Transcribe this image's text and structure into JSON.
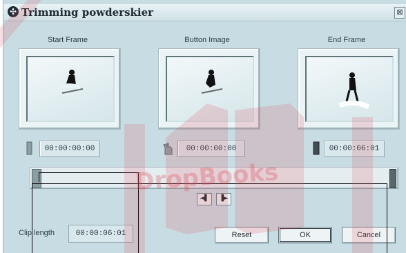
{
  "window": {
    "title": "Trimming powderskier",
    "close_glyph": "⊠"
  },
  "frames": [
    {
      "label": "Start Frame",
      "timecode": "00:00:00:00",
      "icon": "start-marker-icon"
    },
    {
      "label": "Button Image",
      "timecode": "00:00:00:00",
      "icon": "hand-pointer-icon"
    },
    {
      "label": "End Frame",
      "timecode": "00:00:06:01",
      "icon": "end-marker-icon"
    }
  ],
  "scrubber": {
    "step_back_glyph": "◄▌",
    "step_forward_glyph": "▐►"
  },
  "clip": {
    "label": "Clip length",
    "value": "00:00:06:01"
  },
  "buttons": {
    "reset": "Reset",
    "ok": "OK",
    "cancel": "Cancel"
  },
  "watermark": {
    "text": "DropBooks"
  },
  "colors": {
    "window_bg": "#c8dde3",
    "watermark": "#e04a5a"
  }
}
